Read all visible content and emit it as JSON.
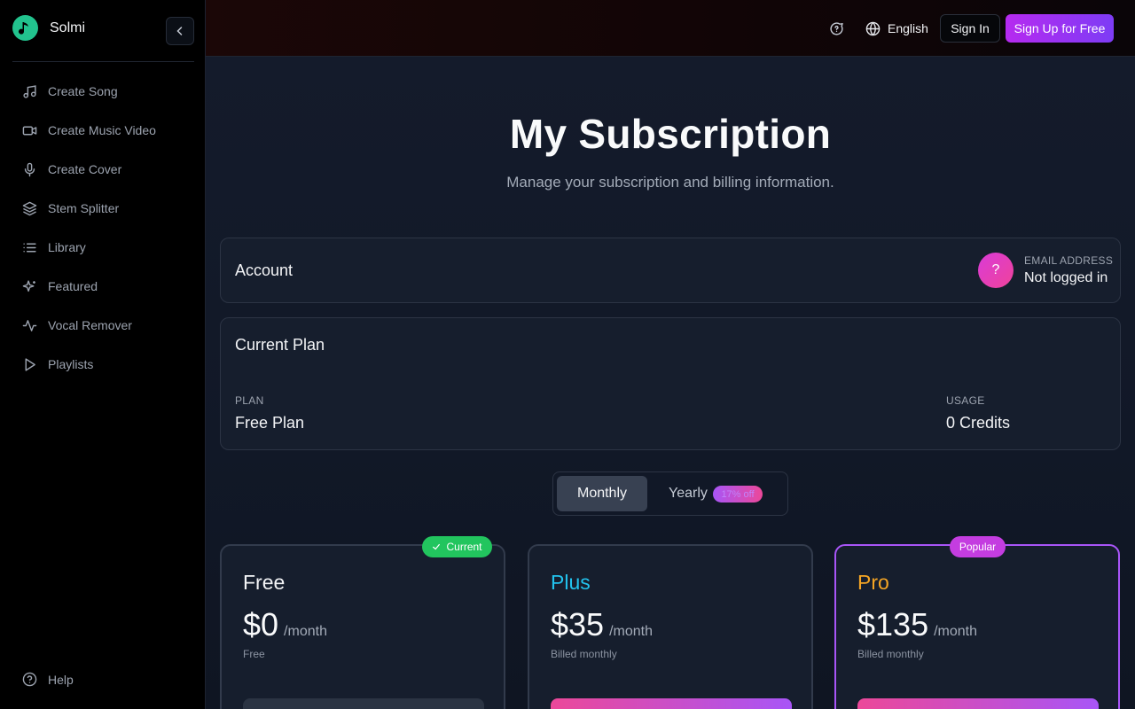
{
  "app": {
    "name": "Solmi",
    "accent": "#22c38e"
  },
  "sidebar": {
    "items": [
      {
        "label": "Create Song",
        "icon": "music-note-icon"
      },
      {
        "label": "Create Music Video",
        "icon": "video-camera-icon"
      },
      {
        "label": "Create Cover",
        "icon": "microphone-icon"
      },
      {
        "label": "Stem Splitter",
        "icon": "layers-icon"
      },
      {
        "label": "Library",
        "icon": "list-icon"
      },
      {
        "label": "Featured",
        "icon": "sparkles-icon"
      },
      {
        "label": "Vocal Remover",
        "icon": "waveform-icon"
      },
      {
        "label": "Playlists",
        "icon": "play-icon"
      }
    ],
    "help_label": "Help"
  },
  "header": {
    "language": "English",
    "signin_label": "Sign In",
    "signup_label": "Sign Up for Free"
  },
  "page": {
    "title": "My Subscription",
    "subtitle": "Manage your subscription and billing information."
  },
  "account": {
    "title": "Account",
    "avatar_text": "?",
    "email_label": "EMAIL ADDRESS",
    "email_value": "Not logged in"
  },
  "current_plan": {
    "title": "Current Plan",
    "plan_label": "PLAN",
    "plan_value": "Free Plan",
    "usage_label": "USAGE",
    "usage_value": "0 Credits"
  },
  "billing_toggle": {
    "monthly_label": "Monthly",
    "yearly_label": "Yearly",
    "discount_label": "17% off",
    "selected": "Monthly"
  },
  "tiers": [
    {
      "name": "Free",
      "price": "$0",
      "period": "/month",
      "note": "Free",
      "badge": "Current",
      "color": "#f3f4f6"
    },
    {
      "name": "Plus",
      "price": "$35",
      "period": "/month",
      "note": "Billed monthly",
      "color": "#22c3ee"
    },
    {
      "name": "Pro",
      "price": "$135",
      "period": "/month",
      "note": "Billed monthly",
      "badge": "Popular",
      "color": "#f5a524"
    }
  ]
}
